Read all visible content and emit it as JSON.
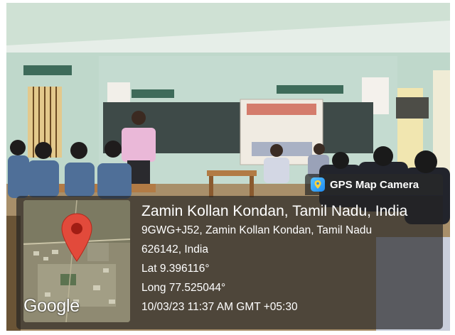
{
  "badge": {
    "label": "GPS Map Camera",
    "icon": "map-camera-icon"
  },
  "map": {
    "brand": "Google",
    "pin_icon": "map-pin-icon"
  },
  "location": {
    "title": "Zamin Kollan Kondan, Tamil Nadu, India",
    "address_line1": "9GWG+J52, Zamin Kollan Kondan, Tamil Nadu",
    "address_line2": "626142, India",
    "latitude": "Lat 9.396116°",
    "longitude": "Long 77.525044°",
    "timestamp": "10/03/23 11:37 AM GMT +05:30"
  },
  "colors": {
    "pin": "#e24a3b",
    "overlay": "#232323",
    "accent": "#2d93f5"
  }
}
